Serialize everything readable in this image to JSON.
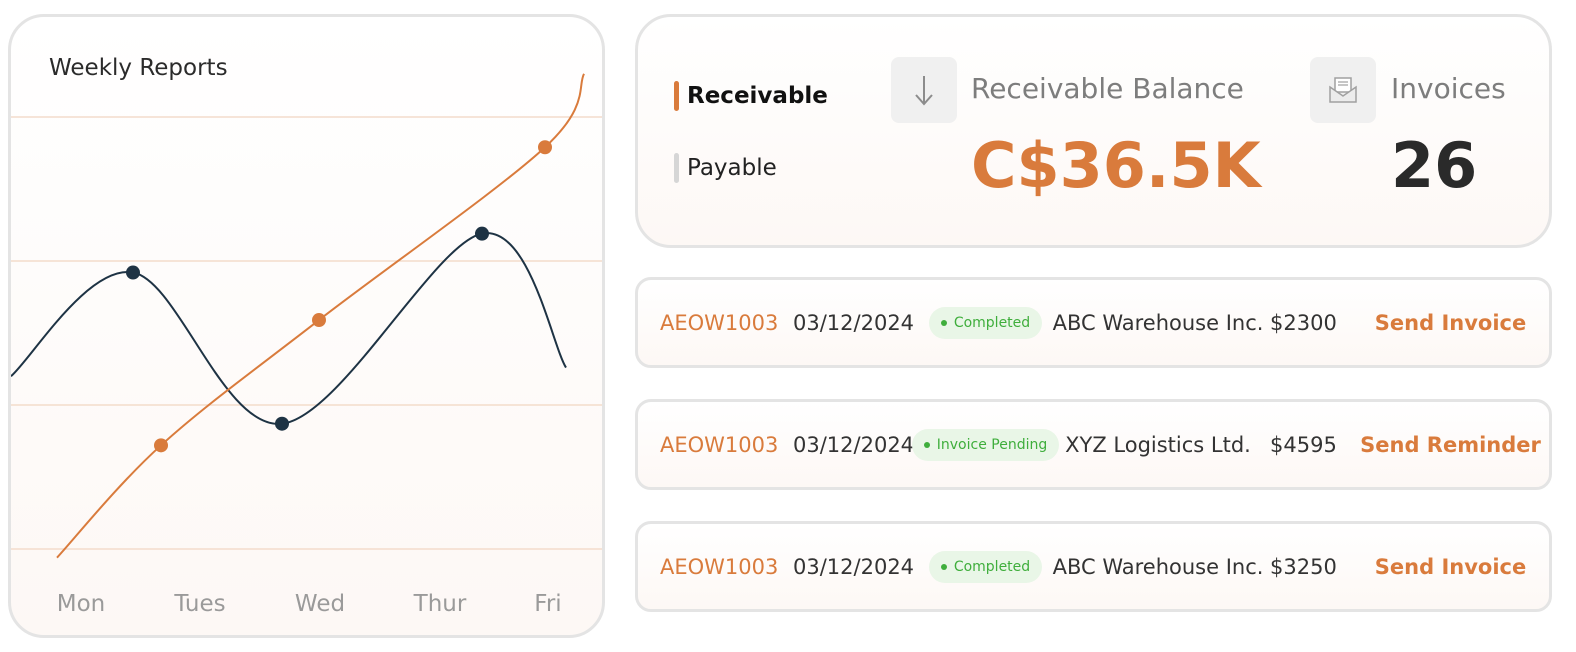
{
  "weekly_reports": {
    "title": "Weekly Reports"
  },
  "chart_data": {
    "type": "line",
    "categories": [
      "Mon",
      "Tues",
      "Wed",
      "Thur",
      "Fri"
    ],
    "grid": true,
    "series": [
      {
        "color": "#1e3344",
        "values": [
          64,
          29,
          73
        ]
      },
      {
        "color": "#d97b3c",
        "values": [
          24,
          53,
          93
        ]
      }
    ]
  },
  "summary": {
    "toggles": {
      "receivable": "Receivable",
      "payable": "Payable"
    },
    "balance": {
      "label": "Receivable Balance",
      "value": "C$36.5K",
      "icon": "arrow-down-icon"
    },
    "invoices": {
      "label": "Invoices",
      "value": "26",
      "icon": "envelope-icon"
    }
  },
  "colors": {
    "accent": "#d97b3c",
    "navy": "#1e3344",
    "success": "#3fae3c"
  },
  "invoice_rows": [
    {
      "id": "AEOW1003",
      "date": "03/12/2024",
      "status": "Completed",
      "company": "ABC Warehouse Inc.",
      "amount": "$2300",
      "action": "Send Invoice"
    },
    {
      "id": "AEOW1003",
      "date": "03/12/2024",
      "status": "Invoice Pending",
      "company": "XYZ Logistics Ltd.",
      "amount": "$4595",
      "action": "Send Reminder"
    },
    {
      "id": "AEOW1003",
      "date": "03/12/2024",
      "status": "Completed",
      "company": "ABC Warehouse Inc.",
      "amount": "$3250",
      "action": "Send Invoice"
    }
  ]
}
